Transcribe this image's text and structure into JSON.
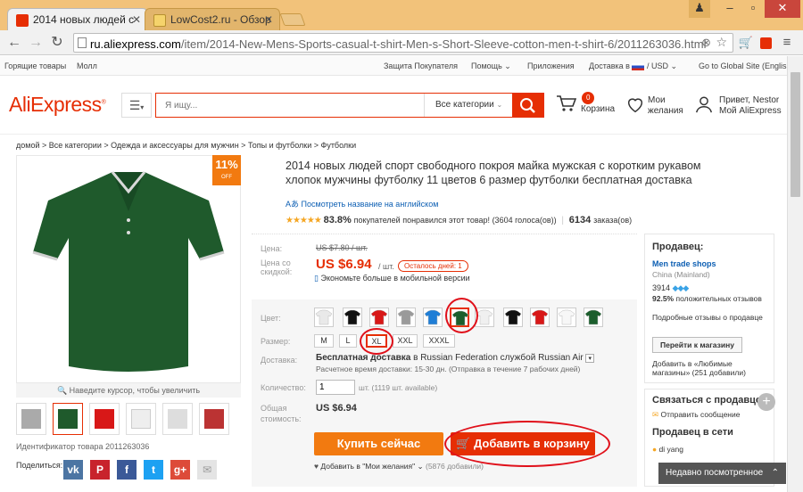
{
  "browser": {
    "tabs": [
      {
        "title": "2014 новых людей с",
        "active": true
      },
      {
        "title": "LowCost2.ru - Обзор",
        "active": false
      }
    ],
    "url_domain": "ru.aliexpress.com",
    "url_path": "/item/2014-New-Mens-Sports-casual-t-shirt-Men-s-Short-Sleeve-cotton-men-t-shirt-6/2011263036.html"
  },
  "topnav": {
    "left": [
      "Горящие товары",
      "Молл"
    ],
    "right": [
      "Защита Покупателя",
      "Помощь",
      "Приложения",
      "Доставка в",
      "/ USD",
      "Go to Global Site (English)"
    ]
  },
  "header": {
    "logo": "AliExpress",
    "search_placeholder": "Я ищу...",
    "search_category": "Все категории",
    "cart_count": "0",
    "cart_label": "Корзина",
    "wishlist_line1": "Мои",
    "wishlist_line2": "желания",
    "account_line1": "Привет, Nestor",
    "account_line2": "Мой AliExpress"
  },
  "breadcrumb": "домой > Все категории > Одежда и аксессуары для мужчин > Топы и футболки > Футболки",
  "gallery": {
    "discount": "11%",
    "discount_sub": "OFF",
    "zoom_hint": "Наведите курсор, чтобы увеличить",
    "product_id_label": "Идентификатор товара 2011263036",
    "share_label": "Поделиться:"
  },
  "product": {
    "title": "2014 новых людей спорт свободного покроя майка мужская с коротким рукавом хлопок мужчины футболку 11 цветов 6 размер футболки бесплатная доставка",
    "translate_link": "Посмотреть название на английском",
    "rating_pct": "83.8%",
    "rating_text": "покупателей понравился этот товар! (3604 голоса(ов))",
    "orders_count": "6134",
    "orders_label": "заказа(ов)",
    "price_label": "Цена:",
    "old_price": "US $7.80 / шт.",
    "discount_price_label": "Цена со скидкой:",
    "price": "US $6.94",
    "price_unit": "/ шт.",
    "days_left": "Осталось дней: 1",
    "mobile_note": "Экономьте больше в мобильной версии",
    "color_label": "Цвет:",
    "colors": [
      "#e9e9e9",
      "#111111",
      "#d81818",
      "#9a9a9a",
      "#1f7ed6",
      "#1b5e2c",
      "#f0f0f0",
      "#111111",
      "#d81818",
      "#f7f7f7",
      "#1b5e2c"
    ],
    "size_label": "Размер:",
    "sizes": [
      "M",
      "L",
      "XL",
      "XXL",
      "XXXL"
    ],
    "shipping_label": "Доставка:",
    "shipping_text": "Бесплатная доставка",
    "shipping_to": "в",
    "shipping_via": "Russian Federation службой Russian Air",
    "shipping_time": "Расчетное время доставки: 15-30 дн. (Отправка в течение 7 рабочих дней)",
    "qty_label": "Количество:",
    "qty_value": "1",
    "qty_unit": "шт. (1119 шт. available)",
    "total_label": "Общая стоимость:",
    "total": "US $6.94",
    "buy_now": "Купить сейчас",
    "add_to_cart": "Добавить в корзину",
    "wishlist": "Добавить в \"Мои желания\"",
    "wishlist_count": "(5876 добавили)"
  },
  "seller": {
    "heading": "Продавец:",
    "name": "Men trade shops",
    "country": "China (Mainland)",
    "score": "3914",
    "positive_pct": "92.5%",
    "positive_label": "положительных отзывов",
    "details": "Подробные отзывы о продавце",
    "visit_store": "Перейти к магазину",
    "favorite": "Добавить в «Любимые магазины» (251 добавили)"
  },
  "contact": {
    "heading": "Связаться с продавцом",
    "message": "Отправить сообщение",
    "online_heading": "Продавец в сети",
    "online_user": "di yang"
  },
  "recent": "Недавно посмотренное",
  "colors": {
    "accent": "#e62e04",
    "orange": "#f27a10",
    "titlebar": "#f2c27a"
  }
}
